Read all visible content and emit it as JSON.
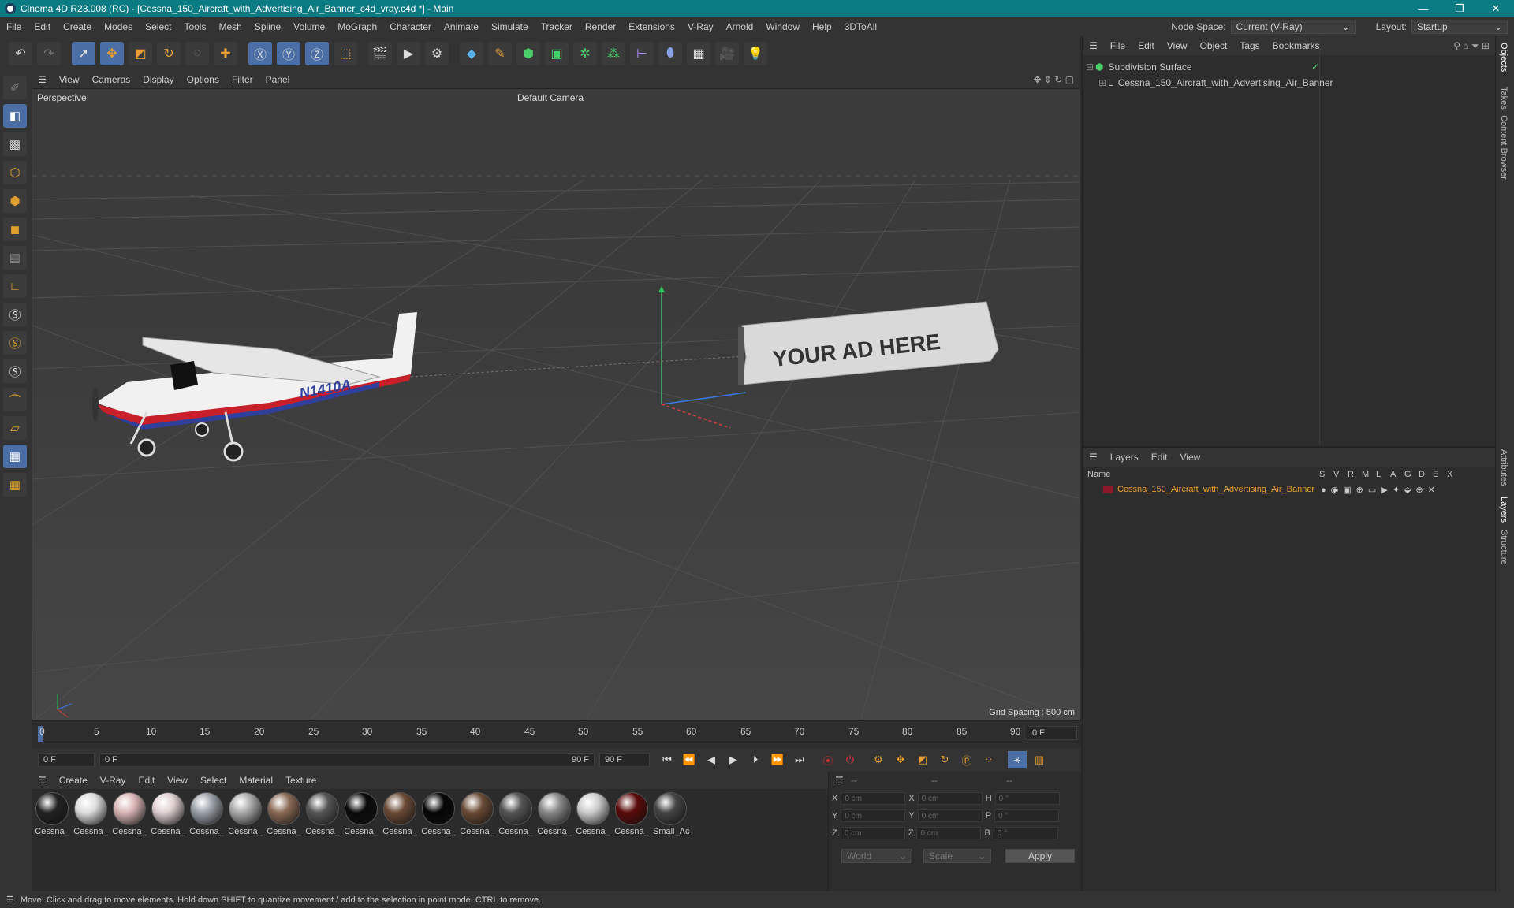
{
  "window": {
    "title": "Cinema 4D R23.008 (RC) - [Cessna_150_Aircraft_with_Advertising_Air_Banner_c4d_vray.c4d *] - Main",
    "minimize": "—",
    "restore": "❐",
    "close": "✕"
  },
  "menu": {
    "items": [
      "File",
      "Edit",
      "Create",
      "Modes",
      "Select",
      "Tools",
      "Mesh",
      "Spline",
      "Volume",
      "MoGraph",
      "Character",
      "Animate",
      "Simulate",
      "Tracker",
      "Render",
      "Extensions",
      "V-Ray",
      "Arnold",
      "Window",
      "Help",
      "3DToAll"
    ],
    "node_space_label": "Node Space:",
    "node_space_value": "Current (V-Ray)",
    "layout_label": "Layout:",
    "layout_value": "Startup"
  },
  "toolbar": {
    "icons": [
      "undo-icon",
      "redo-icon",
      "select-icon",
      "move-icon",
      "scale-icon",
      "rotate-icon",
      "live-select-icon",
      "add-icon",
      "x-axis-icon",
      "y-axis-icon",
      "z-axis-icon",
      "coord-system-icon",
      "render-region-icon",
      "render-view-icon",
      "render-settings-icon",
      "cube-icon",
      "pen-icon",
      "subdivision-icon",
      "extrude-icon",
      "cloner-icon",
      "array-icon",
      "deformer-icon",
      "sphere-icon",
      "floor-icon",
      "camera-icon",
      "light-icon"
    ]
  },
  "viewport": {
    "menu": [
      "View",
      "Cameras",
      "Display",
      "Options",
      "Filter",
      "Panel"
    ],
    "label": "Perspective",
    "camera": "Default Camera",
    "grid_spacing": "Grid Spacing : 500 cm",
    "plane_reg": "N1410A",
    "banner_text": "YOUR AD HERE"
  },
  "timeline": {
    "ticks": [
      "0",
      "5",
      "10",
      "15",
      "20",
      "25",
      "30",
      "35",
      "40",
      "45",
      "50",
      "55",
      "60",
      "65",
      "70",
      "75",
      "80",
      "85",
      "90"
    ],
    "end_field": "0 F"
  },
  "transport": {
    "start": "0 F",
    "range_start": "0 F",
    "range_end": "90 F",
    "end": "90 F"
  },
  "materials": {
    "menu": [
      "Create",
      "V-Ray",
      "Edit",
      "View",
      "Select",
      "Material",
      "Texture"
    ],
    "items": [
      {
        "label": "Cessna_",
        "color": "#222"
      },
      {
        "label": "Cessna_",
        "color": "#ddd"
      },
      {
        "label": "Cessna_",
        "color": "#d9b5b5"
      },
      {
        "label": "Cessna_",
        "color": "#e0d0d0"
      },
      {
        "label": "Cessna_",
        "color": "#9aa0a8"
      },
      {
        "label": "Cessna_",
        "color": "#aaa"
      },
      {
        "label": "Cessna_",
        "color": "#8a6a55"
      },
      {
        "label": "Cessna_",
        "color": "#555"
      },
      {
        "label": "Cessna_",
        "color": "#0a0a0a"
      },
      {
        "label": "Cessna_",
        "color": "#6a4a35"
      },
      {
        "label": "Cessna_",
        "color": "#050505"
      },
      {
        "label": "Cessna_",
        "color": "#6a4a35"
      },
      {
        "label": "Cessna_",
        "color": "#555"
      },
      {
        "label": "Cessna_",
        "color": "#888"
      },
      {
        "label": "Cessna_",
        "color": "#ccc"
      },
      {
        "label": "Cessna_",
        "color": "#5a0a0a"
      },
      {
        "label": "Small_Ac",
        "color": "#444"
      }
    ]
  },
  "coords": {
    "headers": [
      "--",
      "--",
      "--"
    ],
    "rows": [
      {
        "a": "X",
        "av": "0 cm",
        "b": "X",
        "bv": "0 cm",
        "c": "H",
        "cv": "0 °"
      },
      {
        "a": "Y",
        "av": "0 cm",
        "b": "Y",
        "bv": "0 cm",
        "c": "P",
        "cv": "0 °"
      },
      {
        "a": "Z",
        "av": "0 cm",
        "b": "Z",
        "bv": "0 cm",
        "c": "B",
        "cv": "0 °"
      }
    ],
    "world": "World",
    "scale": "Scale",
    "apply": "Apply"
  },
  "objects": {
    "menu": [
      "File",
      "Edit",
      "View",
      "Object",
      "Tags",
      "Bookmarks"
    ],
    "items": [
      "Subdivision Surface",
      "Cessna_150_Aircraft_with_Advertising_Air_Banner"
    ]
  },
  "layers": {
    "menu": [
      "Layers",
      "Edit",
      "View"
    ],
    "col_name": "Name",
    "cols": [
      "S",
      "V",
      "R",
      "M",
      "L",
      "A",
      "G",
      "D",
      "E",
      "X"
    ],
    "items": [
      "Cessna_150_Aircraft_with_Advertising_Air_Banner"
    ]
  },
  "sidetabs": [
    "Objects",
    "Takes",
    "Content Browser",
    "Attributes",
    "Layers",
    "Structure"
  ],
  "status": "Move: Click and drag to move elements. Hold down SHIFT to quantize movement / add to the selection in point mode, CTRL to remove."
}
